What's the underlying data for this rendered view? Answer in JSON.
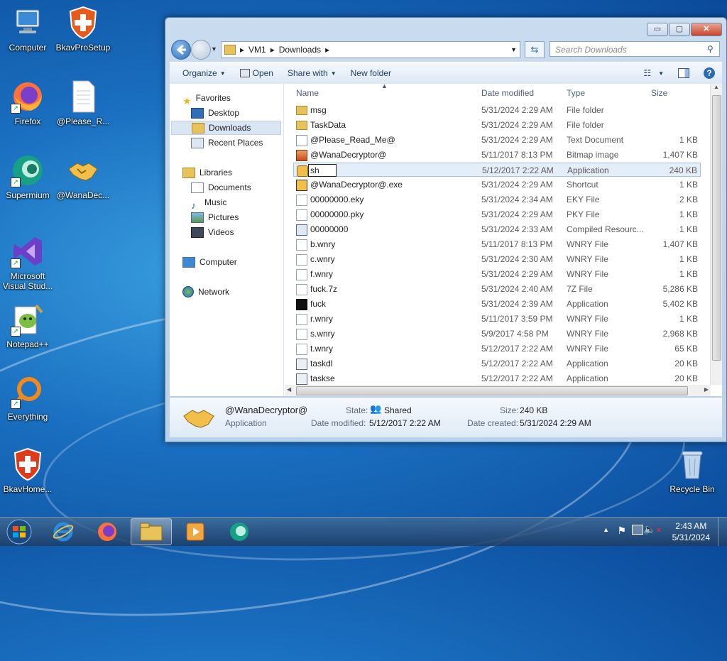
{
  "desktop": {
    "icons": [
      {
        "label": "Computer"
      },
      {
        "label": "BkavProSetup"
      },
      {
        "label": "Firefox"
      },
      {
        "label": "@Please_R..."
      },
      {
        "label": "Supermium"
      },
      {
        "label": "@WanaDec..."
      },
      {
        "label": "Microsoft Visual Stud..."
      },
      {
        "label": "Notepad++"
      },
      {
        "label": "Everything"
      },
      {
        "label": "BkavHome..."
      },
      {
        "label": "Recycle Bin"
      }
    ]
  },
  "explorer": {
    "window_buttons": {
      "minimize": "▭",
      "maximize": "▢",
      "close": "✕"
    },
    "breadcrumb": [
      "VM1",
      "Downloads"
    ],
    "search_placeholder": "Search Downloads",
    "toolbar": {
      "organize": "Organize",
      "open": "Open",
      "share_with": "Share with",
      "new_folder": "New folder"
    },
    "nav": {
      "favorites": "Favorites",
      "desktop": "Desktop",
      "downloads": "Downloads",
      "recent": "Recent Places",
      "libraries": "Libraries",
      "documents": "Documents",
      "music": "Music",
      "pictures": "Pictures",
      "videos": "Videos",
      "computer": "Computer",
      "network": "Network"
    },
    "columns": {
      "name": "Name",
      "date": "Date modified",
      "type": "Type",
      "size": "Size"
    },
    "files": [
      {
        "name": "msg",
        "date": "5/31/2024 2:29 AM",
        "type": "File folder",
        "size": "",
        "icon": "folder-icon"
      },
      {
        "name": "TaskData",
        "date": "5/31/2024 2:29 AM",
        "type": "File folder",
        "size": "",
        "icon": "folder-icon"
      },
      {
        "name": "@Please_Read_Me@",
        "date": "5/31/2024 2:29 AM",
        "type": "Text Document",
        "size": "1 KB",
        "icon": "text-file-icon"
      },
      {
        "name": "@WanaDecryptor@",
        "date": "5/11/2017 8:13 PM",
        "type": "Bitmap image",
        "size": "1,407 KB",
        "icon": "bitmap-icon"
      },
      {
        "name": "sh",
        "date": "5/12/2017 2:22 AM",
        "type": "Application",
        "size": "240 KB",
        "icon": "handshake-icon",
        "renaming": true
      },
      {
        "name": "@WanaDecryptor@.exe",
        "date": "5/31/2024 2:29 AM",
        "type": "Shortcut",
        "size": "1 KB",
        "icon": "shortcut-icon"
      },
      {
        "name": "00000000.eky",
        "date": "5/31/2024 2:34 AM",
        "type": "EKY File",
        "size": "2 KB",
        "icon": "file-icon"
      },
      {
        "name": "00000000.pky",
        "date": "5/31/2024 2:29 AM",
        "type": "PKY File",
        "size": "1 KB",
        "icon": "file-icon"
      },
      {
        "name": "00000000",
        "date": "5/31/2024 2:33 AM",
        "type": "Compiled Resourc...",
        "size": "1 KB",
        "icon": "resource-icon"
      },
      {
        "name": "b.wnry",
        "date": "5/11/2017 8:13 PM",
        "type": "WNRY File",
        "size": "1,407 KB",
        "icon": "file-icon"
      },
      {
        "name": "c.wnry",
        "date": "5/31/2024 2:30 AM",
        "type": "WNRY File",
        "size": "1 KB",
        "icon": "file-icon"
      },
      {
        "name": "f.wnry",
        "date": "5/31/2024 2:29 AM",
        "type": "WNRY File",
        "size": "1 KB",
        "icon": "file-icon"
      },
      {
        "name": "fuck.7z",
        "date": "5/31/2024 2:40 AM",
        "type": "7Z File",
        "size": "5,286 KB",
        "icon": "file-icon"
      },
      {
        "name": "fuck",
        "date": "5/31/2024 2:39 AM",
        "type": "Application",
        "size": "5,402 KB",
        "icon": "7z-app-icon"
      },
      {
        "name": "r.wnry",
        "date": "5/11/2017 3:59 PM",
        "type": "WNRY File",
        "size": "1 KB",
        "icon": "file-icon"
      },
      {
        "name": "s.wnry",
        "date": "5/9/2017 4:58 PM",
        "type": "WNRY File",
        "size": "2,968 KB",
        "icon": "file-icon"
      },
      {
        "name": "t.wnry",
        "date": "5/12/2017 2:22 AM",
        "type": "WNRY File",
        "size": "65 KB",
        "icon": "file-icon"
      },
      {
        "name": "taskdl",
        "date": "5/12/2017 2:22 AM",
        "type": "Application",
        "size": "20 KB",
        "icon": "app-window-icon"
      },
      {
        "name": "taskse",
        "date": "5/12/2017 2:22 AM",
        "type": "Application",
        "size": "20 KB",
        "icon": "app-window-icon"
      }
    ],
    "details": {
      "name": "@WanaDecryptor@",
      "kind": "Application",
      "state_label": "State:",
      "state": "Shared",
      "size_label": "Size:",
      "size": "240 KB",
      "modified_label": "Date modified:",
      "modified": "5/12/2017 2:22 AM",
      "created_label": "Date created:",
      "created": "5/31/2024 2:29 AM"
    }
  },
  "taskbar": {
    "clock_time": "2:43 AM",
    "clock_date": "5/31/2024"
  },
  "colors": {
    "accent": "#3a78c4",
    "selection": "#e4eef9",
    "folder": "#e8c25a"
  }
}
